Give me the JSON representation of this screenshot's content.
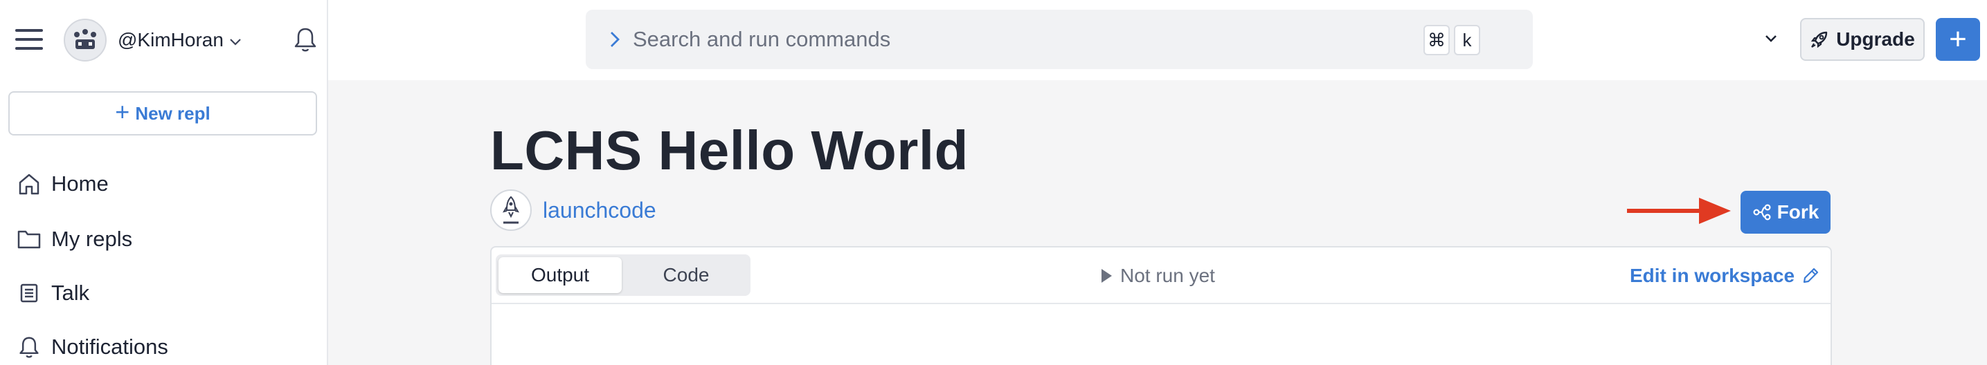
{
  "colors": {
    "accent": "#3a7bd5",
    "annotation_arrow": "#e03a22",
    "page_bg": "#f5f5f6",
    "sidebar_bg": "#ffffff"
  },
  "sidebar": {
    "menu_icon": "hamburger-icon",
    "user": {
      "handle": "@KimHoran",
      "avatar_icon": "crown-avatar-icon",
      "dropdown_icon": "chevron-down-icon"
    },
    "notifications_icon": "bell-icon",
    "new_repl": {
      "icon": "plus-icon",
      "label": "New repl"
    },
    "items": [
      {
        "icon": "home-icon",
        "label": "Home"
      },
      {
        "icon": "folder-icon",
        "label": "My repls"
      },
      {
        "icon": "talk-icon",
        "label": "Talk"
      },
      {
        "icon": "bell-icon",
        "label": "Notifications"
      }
    ]
  },
  "topbar": {
    "search": {
      "prompt_icon": "chevron-right-icon",
      "placeholder": "Search and run commands",
      "shortcut_keys": [
        "⌘",
        "k"
      ],
      "dropdown_icon": "chevron-down-icon"
    },
    "upgrade": {
      "icon": "rocket-icon",
      "label": "Upgrade"
    },
    "create": {
      "icon": "plus-icon",
      "label": "+"
    }
  },
  "repl": {
    "title": "LCHS Hello World",
    "owner": {
      "name": "launchcode",
      "avatar_icon": "rocket-icon"
    },
    "fork": {
      "icon": "fork-icon",
      "label": "Fork"
    },
    "annotation": {
      "icon": "red-arrow-right-icon"
    },
    "tabs": [
      {
        "label": "Output",
        "active": true
      },
      {
        "label": "Code",
        "active": false
      }
    ],
    "run_status": {
      "icon": "play-icon",
      "label": "Not run yet"
    },
    "edit_workspace": {
      "label": "Edit in workspace",
      "icon": "pencil-icon"
    }
  }
}
